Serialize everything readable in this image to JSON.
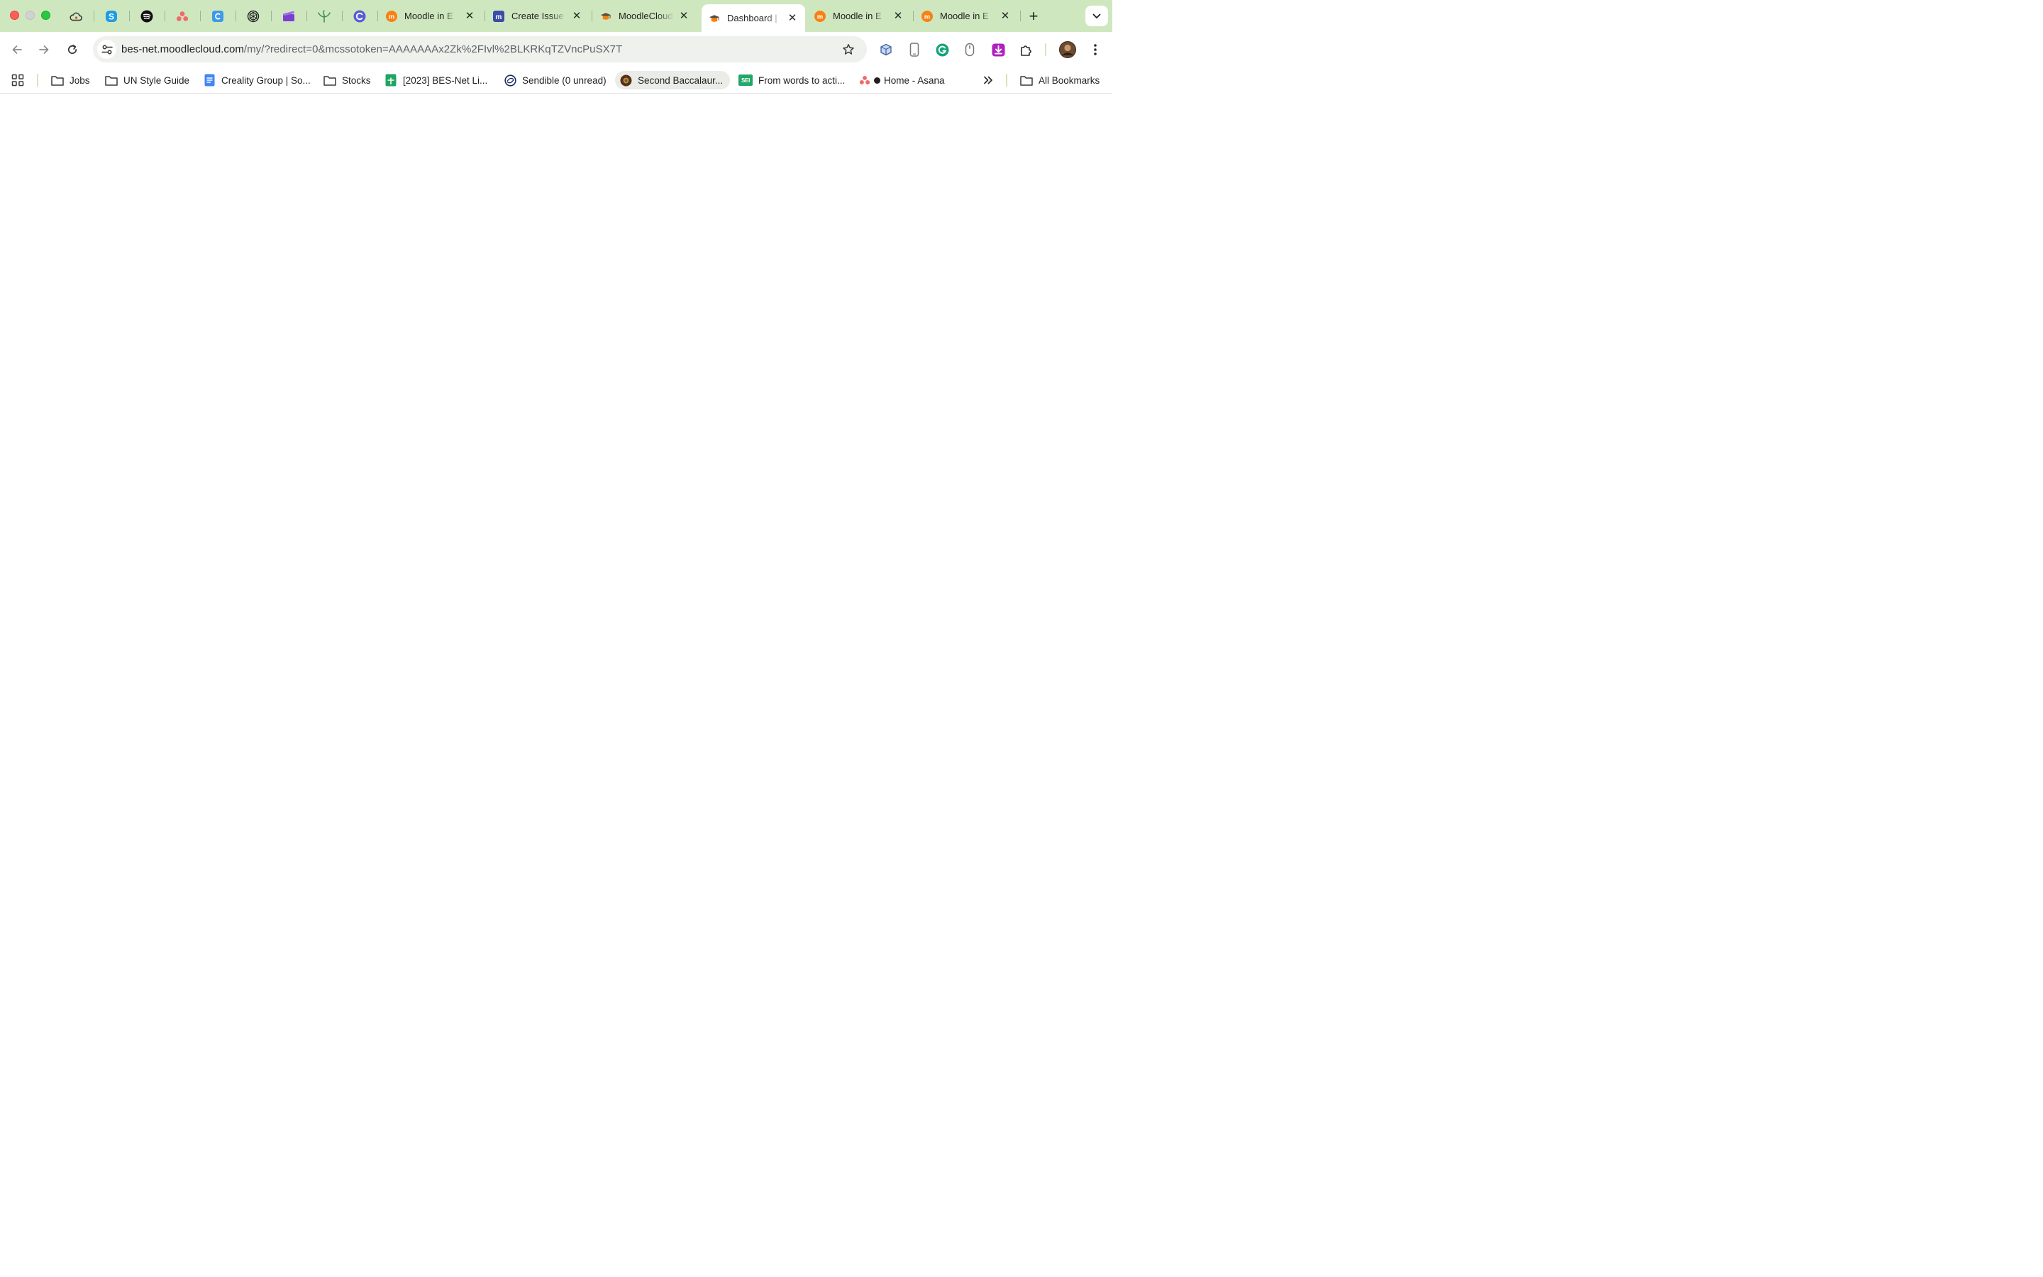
{
  "window": {
    "tabs": [
      {
        "title": "Moodle in E",
        "favicon": "moodle-orange-icon"
      },
      {
        "title": "Create Issue",
        "favicon": "moodle-tracker-icon"
      },
      {
        "title": "MoodleCloud",
        "favicon": "moodle-hat-icon"
      },
      {
        "title": "Dashboard |",
        "favicon": "moodle-hat-icon",
        "active": true
      },
      {
        "title": "Moodle in E",
        "favicon": "moodle-orange-icon"
      },
      {
        "title": "Moodle in E",
        "favicon": "moodle-orange-icon"
      }
    ],
    "pinned_tabs": [
      "cloud-icon",
      "skype-icon",
      "spotify-icon",
      "asana-icon",
      "calendar-icon",
      "chatgpt-icon",
      "clapper-icon",
      "sprout-icon",
      "circle-c-icon"
    ],
    "new_tab_symbol": "+",
    "close_symbol": "✕"
  },
  "toolbar": {
    "url_host": "bes-net.moodlecloud.com",
    "url_rest": "/my/?redirect=0&mcssotoken=AAAAAAAx2Zk%2FIvl%2BLKRKqTZVncPuSX7T",
    "extensions": [
      "cube-extension-icon",
      "phone-extension-icon",
      "grammarly-icon",
      "mouse-extension-icon",
      "download-extension-icon",
      "puzzle-icon"
    ]
  },
  "bookmarks": {
    "items": [
      {
        "label": "Jobs",
        "icon": "folder-icon"
      },
      {
        "label": "UN Style Guide",
        "icon": "folder-icon"
      },
      {
        "label": "Creality Group | So...",
        "icon": "google-docs-icon"
      },
      {
        "label": "Stocks",
        "icon": "folder-icon"
      },
      {
        "label": "[2023] BES-Net Li...",
        "icon": "google-sheets-icon"
      },
      {
        "label": "Sendible (0 unread)",
        "icon": "sendible-icon"
      },
      {
        "label": "Second Baccalaur...",
        "icon": "globe-favicon-icon"
      },
      {
        "label": "From words to acti...",
        "icon": "sei-icon",
        "icon_text": "SEI"
      },
      {
        "label": "Home - Asana",
        "icon": "asana-icon"
      }
    ],
    "all_bookmarks_label": "All Bookmarks"
  },
  "colors": {
    "tabstrip_bg": "#cfe7bf",
    "omnibox_bg": "#eef1ec",
    "moodle_orange": "#f98012"
  }
}
